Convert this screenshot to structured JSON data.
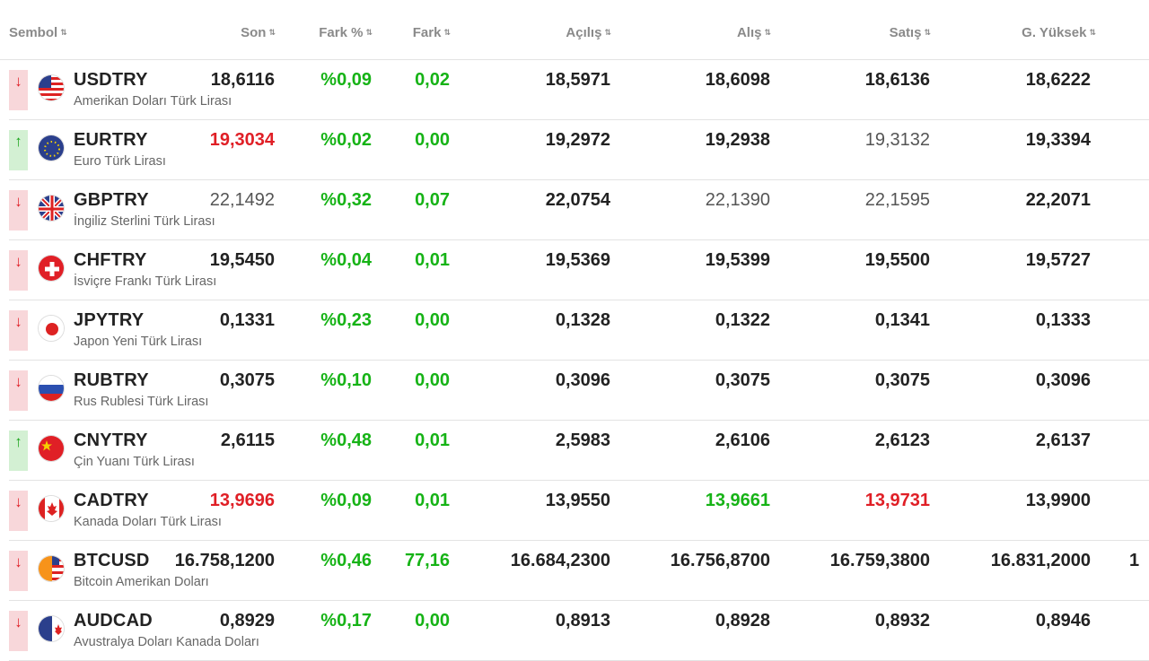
{
  "headers": {
    "sembol": "Sembol",
    "son": "Son",
    "fark_pct": "Fark %",
    "fark": "Fark",
    "acilis": "Açılış",
    "alis": "Alış",
    "satis": "Satış",
    "g_yuksek": "G. Yüksek",
    "sort_icon": "⇅"
  },
  "rows": [
    {
      "trend": "down",
      "trend_glyph": "↓",
      "flag": "us-flag-icon",
      "symbol": "USDTRY",
      "desc": "Amerikan Doları Türk Lirası",
      "son": "18,6116",
      "son_color": "default",
      "pct": "%0,09",
      "fark": "0,02",
      "acilis": "18,5971",
      "alis": "18,6098",
      "alis_color": "default",
      "satis": "18,6136",
      "satis_color": "default",
      "yuksek": "18,6222"
    },
    {
      "trend": "up",
      "trend_glyph": "↑",
      "flag": "eu-flag-icon",
      "symbol": "EURTRY",
      "desc": "Euro Türk Lirası",
      "son": "19,3034",
      "son_color": "red",
      "pct": "%0,02",
      "fark": "0,00",
      "acilis": "19,2972",
      "alis": "19,2938",
      "alis_color": "default",
      "satis": "19,3132",
      "satis_color": "gray",
      "yuksek": "19,3394"
    },
    {
      "trend": "down",
      "trend_glyph": "↓",
      "flag": "gb-flag-icon",
      "symbol": "GBPTRY",
      "desc": "İngiliz Sterlini Türk Lirası",
      "son": "22,1492",
      "son_color": "gray",
      "pct": "%0,32",
      "fark": "0,07",
      "acilis": "22,0754",
      "alis": "22,1390",
      "alis_color": "gray",
      "satis": "22,1595",
      "satis_color": "gray",
      "yuksek": "22,2071"
    },
    {
      "trend": "down",
      "trend_glyph": "↓",
      "flag": "ch-flag-icon",
      "symbol": "CHFTRY",
      "desc": "İsviçre Frankı Türk Lirası",
      "son": "19,5450",
      "son_color": "default",
      "pct": "%0,04",
      "fark": "0,01",
      "acilis": "19,5369",
      "alis": "19,5399",
      "alis_color": "default",
      "satis": "19,5500",
      "satis_color": "default",
      "yuksek": "19,5727"
    },
    {
      "trend": "down",
      "trend_glyph": "↓",
      "flag": "jp-flag-icon",
      "symbol": "JPYTRY",
      "desc": "Japon Yeni Türk Lirası",
      "son": "0,1331",
      "son_color": "default",
      "pct": "%0,23",
      "fark": "0,00",
      "acilis": "0,1328",
      "alis": "0,1322",
      "alis_color": "default",
      "satis": "0,1341",
      "satis_color": "default",
      "yuksek": "0,1333"
    },
    {
      "trend": "down",
      "trend_glyph": "↓",
      "flag": "ru-flag-icon",
      "symbol": "RUBTRY",
      "desc": "Rus Rublesi Türk Lirası",
      "son": "0,3075",
      "son_color": "default",
      "pct": "%0,10",
      "fark": "0,00",
      "acilis": "0,3096",
      "alis": "0,3075",
      "alis_color": "default",
      "satis": "0,3075",
      "satis_color": "default",
      "yuksek": "0,3096"
    },
    {
      "trend": "up",
      "trend_glyph": "↑",
      "flag": "cn-flag-icon",
      "symbol": "CNYTRY",
      "desc": "Çin Yuanı Türk Lirası",
      "son": "2,6115",
      "son_color": "default",
      "pct": "%0,48",
      "fark": "0,01",
      "acilis": "2,5983",
      "alis": "2,6106",
      "alis_color": "default",
      "satis": "2,6123",
      "satis_color": "default",
      "yuksek": "2,6137"
    },
    {
      "trend": "down",
      "trend_glyph": "↓",
      "flag": "ca-flag-icon",
      "symbol": "CADTRY",
      "desc": "Kanada Doları Türk Lirası",
      "son": "13,9696",
      "son_color": "red",
      "pct": "%0,09",
      "fark": "0,01",
      "acilis": "13,9550",
      "alis": "13,9661",
      "alis_color": "green",
      "satis": "13,9731",
      "satis_color": "red",
      "yuksek": "13,9900"
    },
    {
      "trend": "down",
      "trend_glyph": "↓",
      "flag": "btc-us-flag-icon",
      "symbol": "BTCUSD",
      "desc": "Bitcoin Amerikan Doları",
      "son": "16.758,1200",
      "son_color": "default",
      "pct": "%0,46",
      "fark": "77,16",
      "acilis": "16.684,2300",
      "alis": "16.756,8700",
      "alis_color": "default",
      "satis": "16.759,3800",
      "satis_color": "default",
      "yuksek": "16.831,2000",
      "extra": "1"
    },
    {
      "trend": "down",
      "trend_glyph": "↓",
      "flag": "au-ca-flag-icon",
      "symbol": "AUDCAD",
      "desc": "Avustralya Doları Kanada Doları",
      "son": "0,8929",
      "son_color": "default",
      "pct": "%0,17",
      "fark": "0,00",
      "acilis": "0,8913",
      "alis": "0,8928",
      "alis_color": "default",
      "satis": "0,8932",
      "satis_color": "default",
      "yuksek": "0,8946"
    }
  ],
  "colors": {
    "down": "#e01f26",
    "up": "#16b316",
    "down_bg": "#f8d7da",
    "up_bg": "#d3f0d3"
  }
}
